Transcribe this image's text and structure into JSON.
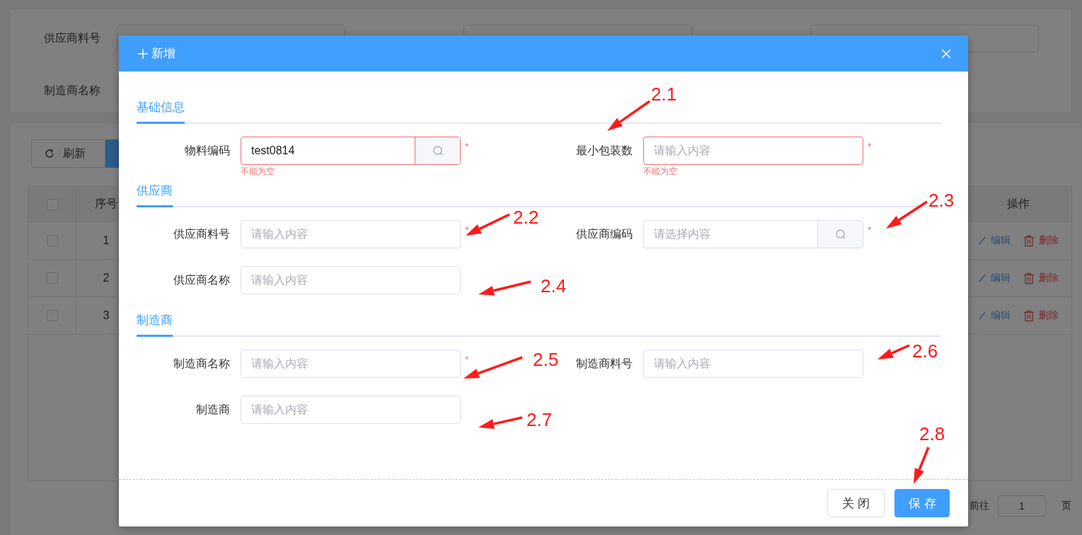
{
  "background": {
    "search_form": [
      {
        "label": "供应商料号"
      },
      {
        "label": "制造商名称"
      }
    ],
    "toolbar": {
      "refresh_button": "刷新"
    },
    "table": {
      "columns": [
        "序号",
        "操作"
      ],
      "select_all_checked": false,
      "rows": [
        {
          "index": "1",
          "checked": false,
          "actions": [
            "编辑",
            "删除"
          ]
        },
        {
          "index": "2",
          "checked": false,
          "actions": [
            "编辑",
            "删除"
          ]
        },
        {
          "index": "3",
          "checked": false,
          "actions": [
            "编辑",
            "删除"
          ]
        }
      ]
    },
    "pagination": {
      "goto_label": "前往",
      "page": "1",
      "page_suffix": "页"
    }
  },
  "dialog": {
    "title": "新增",
    "sections": [
      {
        "title": "基础信息",
        "rows": [
          [
            {
              "label": "物料编码",
              "value": "test0814",
              "lookup": true,
              "required_mark": "*",
              "error": "不能为空"
            },
            {
              "label": "最小包装数",
              "placeholder": "请输入内容",
              "lookup": false,
              "required_mark": "*",
              "error": "不能为空"
            }
          ]
        ]
      },
      {
        "title": "供应商",
        "rows": [
          [
            {
              "label": "供应商料号",
              "placeholder": "请输入内容",
              "lookup": false,
              "required_mark": "*"
            },
            {
              "label": "供应商编码",
              "placeholder": "请选择内容",
              "lookup": true,
              "required_mark": "*"
            }
          ],
          [
            {
              "label": "供应商名称",
              "placeholder": "请输入内容",
              "lookup": false
            }
          ]
        ]
      },
      {
        "title": "制造商",
        "rows": [
          [
            {
              "label": "制造商名称",
              "placeholder": "请输入内容",
              "lookup": false,
              "required_mark": "*"
            },
            {
              "label": "制造商料号",
              "placeholder": "请输入内容",
              "lookup": false
            }
          ],
          [
            {
              "label": "制造商",
              "placeholder": "请输入内容",
              "lookup": false
            }
          ]
        ]
      }
    ],
    "buttons": [
      {
        "label": "关闭",
        "kind": "default"
      },
      {
        "label": "保存",
        "kind": "primary"
      }
    ]
  },
  "annotations": [
    {
      "label": "2.1"
    },
    {
      "label": "2.2"
    },
    {
      "label": "2.3"
    },
    {
      "label": "2.4"
    },
    {
      "label": "2.5"
    },
    {
      "label": "2.6"
    },
    {
      "label": "2.7"
    },
    {
      "label": "2.8"
    }
  ]
}
